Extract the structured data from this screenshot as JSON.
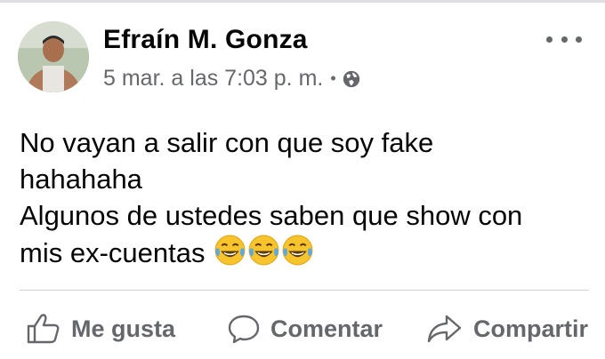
{
  "post": {
    "author_name": "Efraín M. Gonza",
    "timestamp": "5 mar. a las 7:03 p. m.",
    "separator": "•",
    "privacy_icon": "globe-icon",
    "more_icon": "more-horizontal-icon",
    "body_lines": [
      "No vayan a salir con que soy fake",
      "hahahaha",
      "Algunos de ustedes saben que show con",
      "mis ex-cuentas"
    ],
    "emoji": [
      "😂",
      "😂",
      "😂"
    ],
    "emoji_icon": "tears-of-joy-emoji"
  },
  "actions": {
    "like_label": "Me gusta",
    "comment_label": "Comentar",
    "share_label": "Compartir",
    "like_icon": "thumbs-up-icon",
    "comment_icon": "comment-bubble-icon",
    "share_icon": "share-arrow-icon"
  },
  "colors": {
    "text_primary": "#050505",
    "text_secondary": "#65676b",
    "divider": "#ced0d4",
    "emoji_face": "#f8c42d"
  }
}
